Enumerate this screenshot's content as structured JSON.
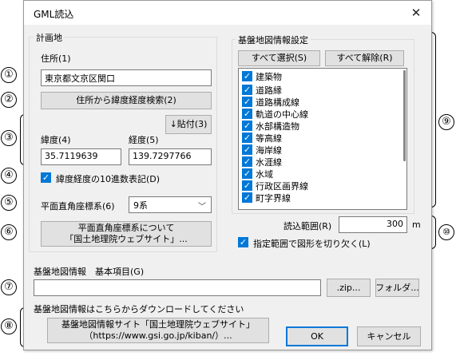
{
  "window": {
    "title": "GML読込",
    "close_glyph": "✕"
  },
  "left_group": {
    "title": "計画地",
    "address_label": "住所(1)",
    "address_value": "東京都文京区関口",
    "search_button": "住所から緯度経度検索(2)",
    "paste_button": "↓貼付(3)",
    "lat_label": "緯度(4)",
    "lat_value": "35.7119639",
    "lon_label": "経度(5)",
    "lon_value": "139.7297766",
    "decimal_checkbox": "緯度経度の10進数表記(D)",
    "coord_system_label": "平面直角座標系(6)",
    "coord_system_value": "9系",
    "about_button_line1": "平面直角座標系について",
    "about_button_line2": "「国土地理院ウェブサイト」..."
  },
  "right_group": {
    "title": "基盤地図情報設定",
    "select_all_button": "すべて選択(S)",
    "deselect_all_button": "すべて解除(R)",
    "layers": [
      "建築物",
      "道路縁",
      "道路構成線",
      "軌道の中心線",
      "水部構造物",
      "等高線",
      "海岸線",
      "水涯線",
      "水域",
      "行政区画界線",
      "町字界線"
    ],
    "range_label": "読込範囲(R)",
    "range_value": "300",
    "range_unit": "m",
    "clip_checkbox": "指定範囲で図形を切り欠く(L)"
  },
  "basic": {
    "label": "基盤地図情報　基本項目(G)",
    "path_value": "",
    "zip_button": ".zip...",
    "folder_button": "フォルダ..."
  },
  "download": {
    "label": "基盤地図情報はこちらからダウンロードしてください",
    "site_button_line1": "基盤地図情報サイト「国土地理院ウェブサイト」",
    "site_button_line2": "（https://www.gsi.go.jp/kiban/）...",
    "ok_button": "OK",
    "cancel_button": "キャンセル"
  },
  "markers": [
    "①",
    "②",
    "③",
    "④",
    "⑤",
    "⑥",
    "⑦",
    "⑧",
    "⑨",
    "⑩"
  ]
}
